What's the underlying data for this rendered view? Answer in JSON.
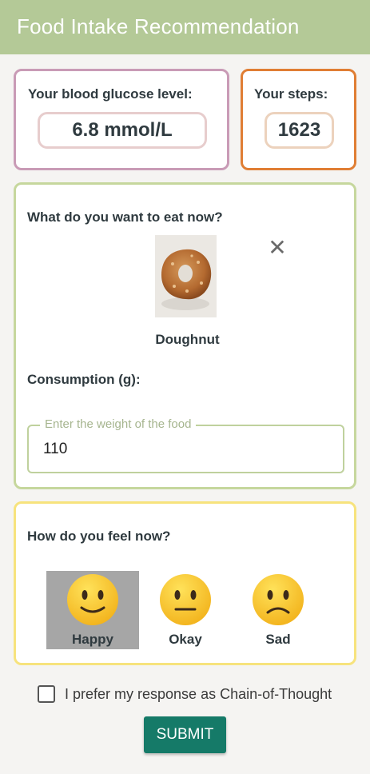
{
  "header": {
    "title": "Food Intake Recommendation"
  },
  "glucose": {
    "label": "Your blood glucose level:",
    "value": "6.8 mmol/L"
  },
  "steps": {
    "label": "Your steps:",
    "value": "1623"
  },
  "food": {
    "question": "What do you want to eat now?",
    "item_name": "Doughnut",
    "consumption_label": "Consumption (g):",
    "weight_placeholder": "Enter the weight of the food",
    "weight_value": "110",
    "remove_icon": "close-icon",
    "image_icon": "doughnut-photo"
  },
  "mood": {
    "question": "How do you feel now?",
    "selected": "Happy",
    "options": [
      {
        "label": "Happy",
        "icon": "slightly-smiling-face"
      },
      {
        "label": "Okay",
        "icon": "neutral-face"
      },
      {
        "label": "Sad",
        "icon": "slightly-frowning-face"
      }
    ]
  },
  "cot": {
    "label": "I prefer my response as Chain-of-Thought",
    "checked": false
  },
  "submit": {
    "label": "SUBMIT"
  },
  "colors": {
    "header": "#b4c997",
    "glucose_border": "#c99bb6",
    "steps_border": "#e07e34",
    "food_border": "#c6d79d",
    "mood_border": "#f7e37d",
    "submit": "#157a68"
  }
}
